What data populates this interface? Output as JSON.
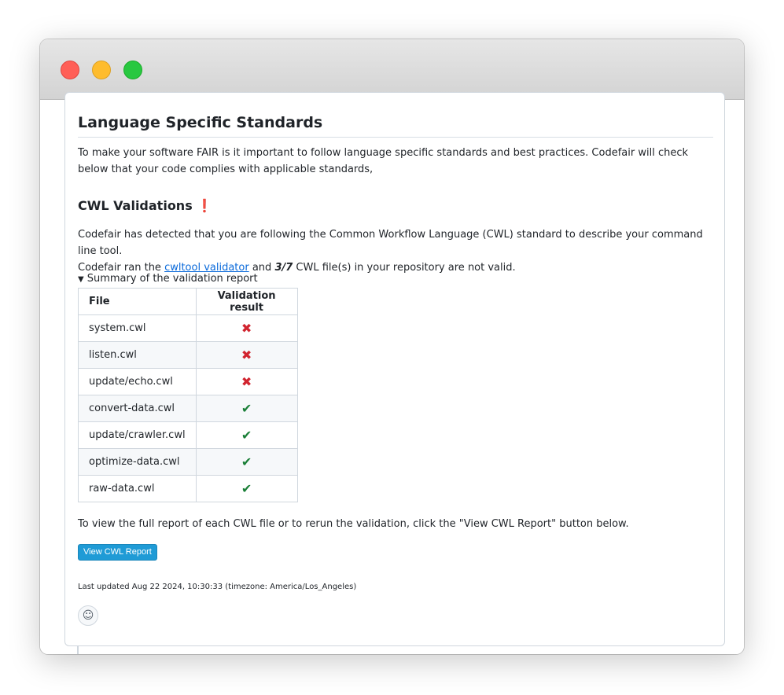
{
  "heading": "Language Specific Standards",
  "intro": "To make your software FAIR is it important to follow language specific standards and best practices. Codefair will check below that your code complies with applicable standards,",
  "cwl": {
    "title": "CWL Validations",
    "status_glyph": "❗",
    "line1": "Codefair has detected that you are following the Common Workflow Language (CWL) standard to describe your command line tool.",
    "line2_prefix": "Codefair ran the ",
    "link_text": "cwltool validator",
    "line2_middle": " and ",
    "invalid_count": "3/7",
    "line2_suffix": " CWL file(s) in your repository are not valid."
  },
  "summary": {
    "label": "Summary of the validation report",
    "toggle_glyph": "▼",
    "headers": [
      "File",
      "Validation result"
    ],
    "rows": [
      {
        "file": "system.cwl",
        "result": "✖",
        "valid": false
      },
      {
        "file": "listen.cwl",
        "result": "✖",
        "valid": false
      },
      {
        "file": "update/echo.cwl",
        "result": "✖",
        "valid": false
      },
      {
        "file": "convert-data.cwl",
        "result": "✔",
        "valid": true
      },
      {
        "file": "update/crawler.cwl",
        "result": "✔",
        "valid": true
      },
      {
        "file": "optimize-data.cwl",
        "result": "✔",
        "valid": true
      },
      {
        "file": "raw-data.cwl",
        "result": "✔",
        "valid": true
      }
    ]
  },
  "footer_text": "To view the full report of each CWL file or to rerun the validation, click the \"View CWL Report\" button below.",
  "button_label": "View CWL Report",
  "last_updated": "Last updated Aug 22 2024, 10:30:33 (timezone: America/Los_Angeles)",
  "reaction_glyph": "☺",
  "colors": {
    "button": "#1f9bd6",
    "link": "#0969da",
    "invalid": "#d1242f",
    "valid": "#1a7f37"
  },
  "icons": {
    "invalid": "x-mark-icon",
    "valid": "check-mark-icon",
    "reaction": "smiley-icon"
  }
}
